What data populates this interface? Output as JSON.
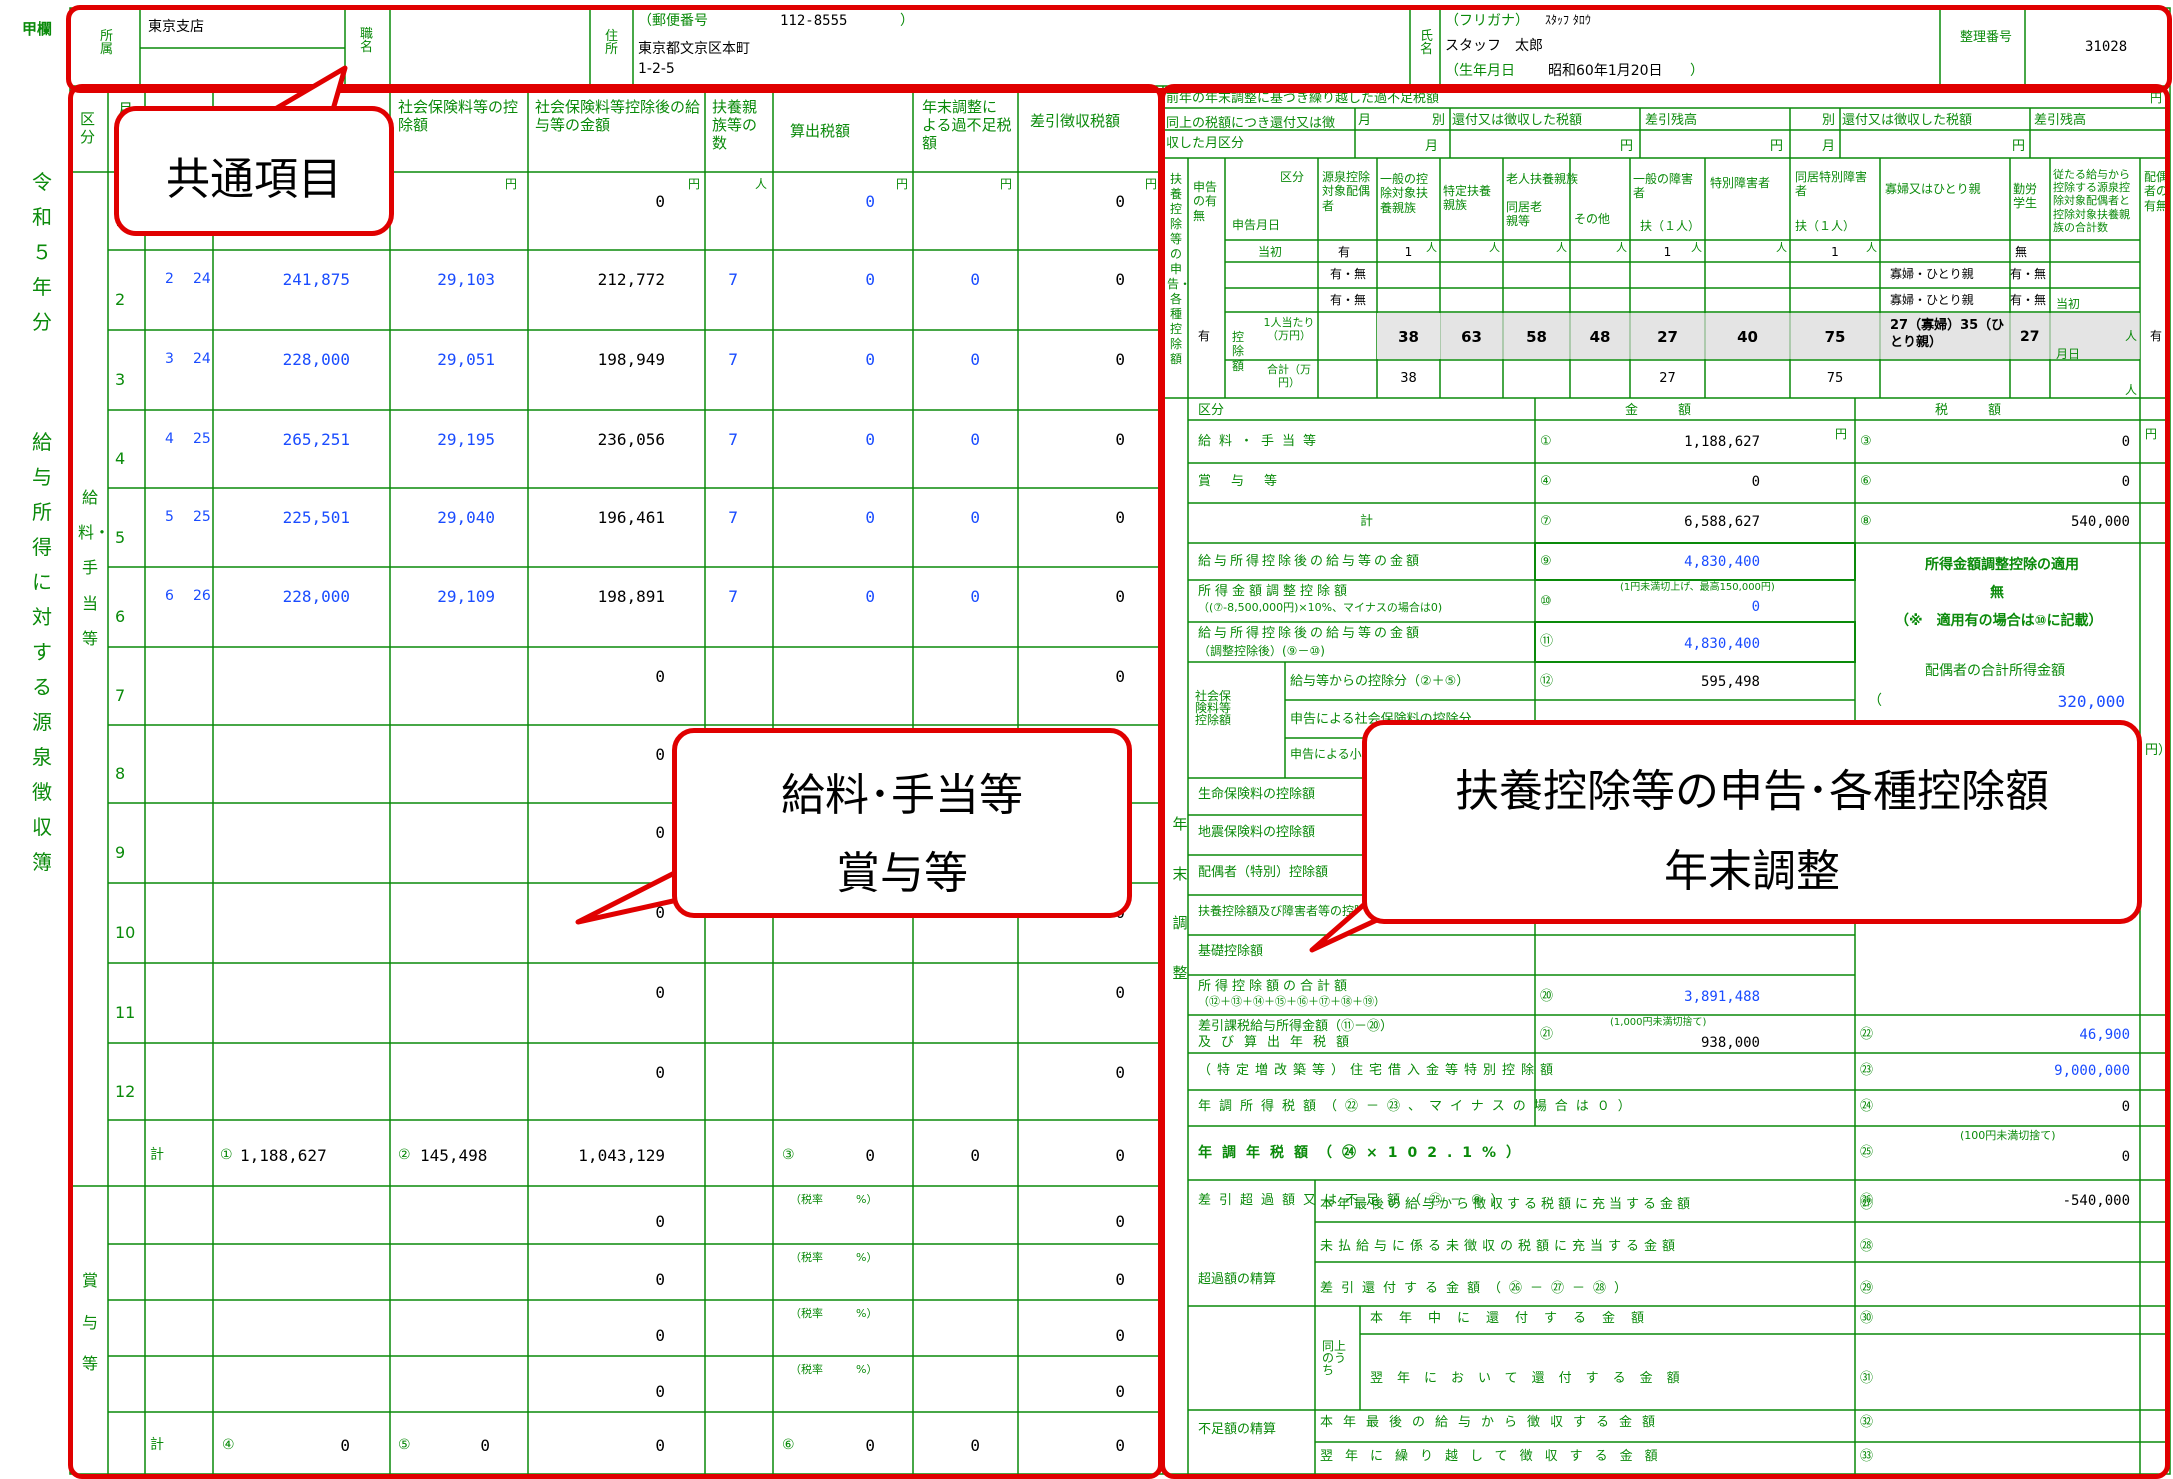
{
  "doc": {
    "kou": "甲欄",
    "side_title_1": "令和５年分",
    "side_title_2": "給与所得に対する源泉徴収簿"
  },
  "header": {
    "shozoku_label": "所属",
    "shozoku_value": "東京支店",
    "shokumei_label": "職名",
    "jusho_label": "住所",
    "postal_label": "（郵便番号",
    "postal_value": "112-8555",
    "postal_close": "）",
    "address_1": "東京都文京区本町",
    "address_2": "1-2-5",
    "shimei_label": "氏名",
    "furigana_label": "（フリガナ）",
    "furigana_value": "ｽﾀｯﾌ ﾀﾛｳ",
    "name_value": "スタッフ　太郎",
    "birth_label": "（生年月日",
    "birth_value": "昭和60年1月20日",
    "birth_close": "）",
    "seiri_label": "整理番号",
    "seiri_value": "31028"
  },
  "left_table": {
    "headers": {
      "kubun": "区分",
      "tsuki": "月",
      "shakai": "社会保険料等の控除額",
      "kojogo": "社会保険料等控除後の給与等の金額",
      "fuyo": "扶養親族等の数",
      "sanshutsu": "算出税額",
      "nenmatsu": "年末調整による過不足税額",
      "sashihiki": "差引徴収税額"
    },
    "unit_yen": "円",
    "unit_nin": "人",
    "kyuyo_label": "給料・手当等",
    "shoyo_label": "賞与等",
    "rows": [
      {
        "no": "1",
        "m": "",
        "d": "",
        "amount": "",
        "shakai": "",
        "after": "0",
        "fuyo": "",
        "tax": "0",
        "nenmatsu": "",
        "sashihiki": "0"
      },
      {
        "no": "2",
        "m": "2",
        "d": "24",
        "amount": "241,875",
        "shakai": "29,103",
        "after": "212,772",
        "fuyo": "7",
        "tax": "0",
        "nenmatsu": "0",
        "sashihiki": "0"
      },
      {
        "no": "3",
        "m": "3",
        "d": "24",
        "amount": "228,000",
        "shakai": "29,051",
        "after": "198,949",
        "fuyo": "7",
        "tax": "0",
        "nenmatsu": "0",
        "sashihiki": "0"
      },
      {
        "no": "4",
        "m": "4",
        "d": "25",
        "amount": "265,251",
        "shakai": "29,195",
        "after": "236,056",
        "fuyo": "7",
        "tax": "0",
        "nenmatsu": "0",
        "sashihiki": "0"
      },
      {
        "no": "5",
        "m": "5",
        "d": "25",
        "amount": "225,501",
        "shakai": "29,040",
        "after": "196,461",
        "fuyo": "7",
        "tax": "0",
        "nenmatsu": "0",
        "sashihiki": "0"
      },
      {
        "no": "6",
        "m": "6",
        "d": "26",
        "amount": "228,000",
        "shakai": "29,109",
        "after": "198,891",
        "fuyo": "7",
        "tax": "0",
        "nenmatsu": "0",
        "sashihiki": "0"
      },
      {
        "no": "7",
        "m": "",
        "d": "",
        "amount": "",
        "shakai": "",
        "after": "0",
        "fuyo": "",
        "tax": "",
        "nenmatsu": "",
        "sashihiki": "0"
      },
      {
        "no": "8",
        "m": "",
        "d": "",
        "amount": "",
        "shakai": "",
        "after": "0",
        "fuyo": "",
        "tax": "",
        "nenmatsu": "",
        "sashihiki": "0"
      },
      {
        "no": "9",
        "m": "",
        "d": "",
        "amount": "",
        "shakai": "",
        "after": "0",
        "fuyo": "",
        "tax": "",
        "nenmatsu": "",
        "sashihiki": "0"
      },
      {
        "no": "10",
        "m": "",
        "d": "",
        "amount": "",
        "shakai": "",
        "after": "0",
        "fuyo": "",
        "tax": "",
        "nenmatsu": "",
        "sashihiki": "0"
      },
      {
        "no": "11",
        "m": "",
        "d": "",
        "amount": "",
        "shakai": "",
        "after": "0",
        "fuyo": "",
        "tax": "",
        "nenmatsu": "",
        "sashihiki": "0"
      },
      {
        "no": "12",
        "m": "",
        "d": "",
        "amount": "",
        "shakai": "",
        "after": "0",
        "fuyo": "",
        "tax": "",
        "nenmatsu": "",
        "sashihiki": "0"
      }
    ],
    "kei_label": "計",
    "kei_row": {
      "c1": "①",
      "amount": "1,188,627",
      "c2": "②",
      "shakai": "145,498",
      "after": "1,043,129",
      "c3": "③",
      "tax": "0",
      "nenmatsu": "0",
      "sashihiki": "0"
    },
    "bonus_rows": [
      {
        "after": "0",
        "rate": "（税率　　　%）",
        "sashihiki": "0"
      },
      {
        "after": "0",
        "rate": "（税率　　　%）",
        "sashihiki": "0"
      },
      {
        "after": "0",
        "rate": "（税率　　　%）",
        "sashihiki": "0"
      },
      {
        "after": "0",
        "rate": "（税率　　　%）",
        "sashihiki": "0"
      }
    ],
    "bonus_kei": {
      "c4": "④",
      "amount": "0",
      "c5": "⑤",
      "shakai": "0",
      "after": "0",
      "c6": "⑥",
      "tax": "0",
      "nenmatsu": "0",
      "sashihiki": "0"
    }
  },
  "right_top": {
    "title": "前年の年末調整に基づき繰り越した過不足税額",
    "row1": "同上の税額につき還付又は徴収した月区分",
    "tsuki": "月",
    "betsu": "別",
    "kanpu": "還付又は徴収した税額",
    "sashihiki_zan": "差引残高",
    "yen": "円"
  },
  "fuyo": {
    "side": "扶養控除等の申告・各種控除額",
    "shinkoku": "申告の有無",
    "kubun": "区分",
    "shinkoku_date": "申告月日",
    "col_gensen": "源泉控除対象配偶者",
    "col_ippan": "一般の控除対象扶養親族",
    "col_tokutei": "特定扶養親族",
    "col_rojin": "老人扶養親族",
    "col_doukyo": "同居老親等",
    "col_sonota": "その他",
    "col_ippan_sho": "一般の障害者",
    "col_tokubetsu": "特別障害者",
    "col_doukyo_toku": "同居特別障害者",
    "col_kafu": "寡婦又はひとり親",
    "col_kinro": "勤労学生",
    "col_jugen": "従たる給与から控除する源泉控除対象配偶者と控除対象扶養親族の合計数",
    "col_haiguusha": "配偶者の有無",
    "fu_1nin": "扶（１人）",
    "row_toshio": "当初",
    "ari": "有",
    "ari_mu": "有・無",
    "mu": "無",
    "kafu_opt": "寡婦・ひとり親",
    "vals_1": [
      "1",
      "",
      "",
      "",
      "1",
      "",
      "1"
    ],
    "kojo_label": "控除額",
    "per_person": "1人当たり（万円）",
    "gokei_label": "合計（万円）",
    "per": [
      "38",
      "63",
      "58",
      "48",
      "27",
      "40",
      "75"
    ],
    "kafu_per": "27（寡婦）35（ひとり親）",
    "kinro_per": "27",
    "sum": [
      "38",
      "",
      "",
      "",
      "27",
      "",
      "75"
    ],
    "gappi": "月日",
    "nin": "人"
  },
  "nenmatsu": {
    "side": "年末調整",
    "h_kubun": "区分",
    "h_kingaku": "金額",
    "h_zeigaku": "税額",
    "r1": "給料・手当等",
    "r1n": "①",
    "r1v": "1,188,627",
    "r1t": "③",
    "r1tv": "0",
    "r2": "賞与等",
    "r2n": "④",
    "r2v": "0",
    "r2t": "⑥",
    "r2tv": "0",
    "r3": "計",
    "r3n": "⑦",
    "r3v": "6,588,627",
    "r3t": "⑧",
    "r3tv": "540,000",
    "r4": "給与所得控除後の給与等の金額",
    "r4n": "⑨",
    "r4v": "4,830,400",
    "r5": "所得金額調整控除額",
    "r5b": "（(⑦-8,500,000円)×10%、マイナスの場合は0)",
    "r5note": "(1円未満切上げ、最高150,000円)",
    "r5n": "⑩",
    "r5v": "0",
    "r6": "給与所得控除後の給与等の金額",
    "r6b": "（調整控除後）(⑨－⑩)",
    "r6n": "⑪",
    "r6v": "4,830,400",
    "r7side": "社会保険料等控除額",
    "r7": "給与等からの控除分（②＋⑤）",
    "r7n": "⑫",
    "r7v": "595,498",
    "r8": "申告による社会保険料の控除分",
    "r9": "申告による小規模企業共済等掛金の控除分",
    "r10": "生命保険料の控除額",
    "r11": "地震保険料の控除額",
    "r12": "配偶者（特別）控除額",
    "r13": "扶養控除額及び障害者等の控除額の合計額",
    "r14": "基礎控除額",
    "r15": "所得控除額の合計額",
    "r15b": "（⑫＋⑬＋⑭＋⑮＋⑯＋⑰＋⑱＋⑲）",
    "r15n": "⑳",
    "r15v": "3,891,488",
    "r16": "差引課税給与所得金額（⑪－⑳）",
    "r16b": "及び算出年税額",
    "r16note": "(1,000円未満切捨て)",
    "r16n": "㉑",
    "r16v": "938,000",
    "r16t": "㉒",
    "r16tv": "46,900",
    "r17": "（特定増改築等）住宅借入金等特別控除額",
    "r17n": "㉓",
    "r17v": "9,000,000",
    "r18": "年調所得税額（㉒－㉓、マイナスの場合は０）",
    "r18n": "㉔",
    "r18v": "0",
    "r19": "年調年税額（㉔×102.1%）",
    "r19note": "(100円未満切捨て)",
    "r19n": "㉕",
    "r19v": "0",
    "r20": "差引超過額又は不足額（㉕－⑧）",
    "r20n": "㉖",
    "r20v": "-540,000",
    "chouka": "超過額の精算",
    "c1": "本年最後の給与から徴収する税額に充当する金額",
    "c1n": "㉗",
    "c2": "未払給与に係る未徴収の税額に充当する金額",
    "c2n": "㉘",
    "c3": "差引還付する金額（㉖－㉗－㉘）",
    "c3n": "㉙",
    "c4side": "同上のうち",
    "c4": "本年中に還付する金額",
    "c4n": "㉚",
    "c5": "翌年において還付する金額",
    "c5n": "㉛",
    "fusoku": "不足額の精算",
    "f1": "本年最後の給与から徴収する金額",
    "f1n": "㉜",
    "f2": "翌年に繰り越して徴収する金額",
    "f2n": "㉝",
    "adj_title": "所得金額調整控除の適用",
    "adj_value": "無",
    "adj_note": "（※　適用有の場合は⑩に記載）",
    "spouse_label": "配偶者の合計所得金額",
    "spouse_open": "（",
    "spouse_value": "320,000",
    "spouse_unit": "円）",
    "yen": "円"
  },
  "callouts": {
    "common": "共通項目",
    "kyuyo_1": "給料･手当等",
    "kyuyo_2": "賞与等",
    "fuyo_1": "扶養控除等の申告･各種控除額",
    "fuyo_2": "年末調整"
  },
  "colors": {
    "line": "#0a8a0a",
    "callout": "#e00000",
    "value_blue": "#1a4cff"
  }
}
